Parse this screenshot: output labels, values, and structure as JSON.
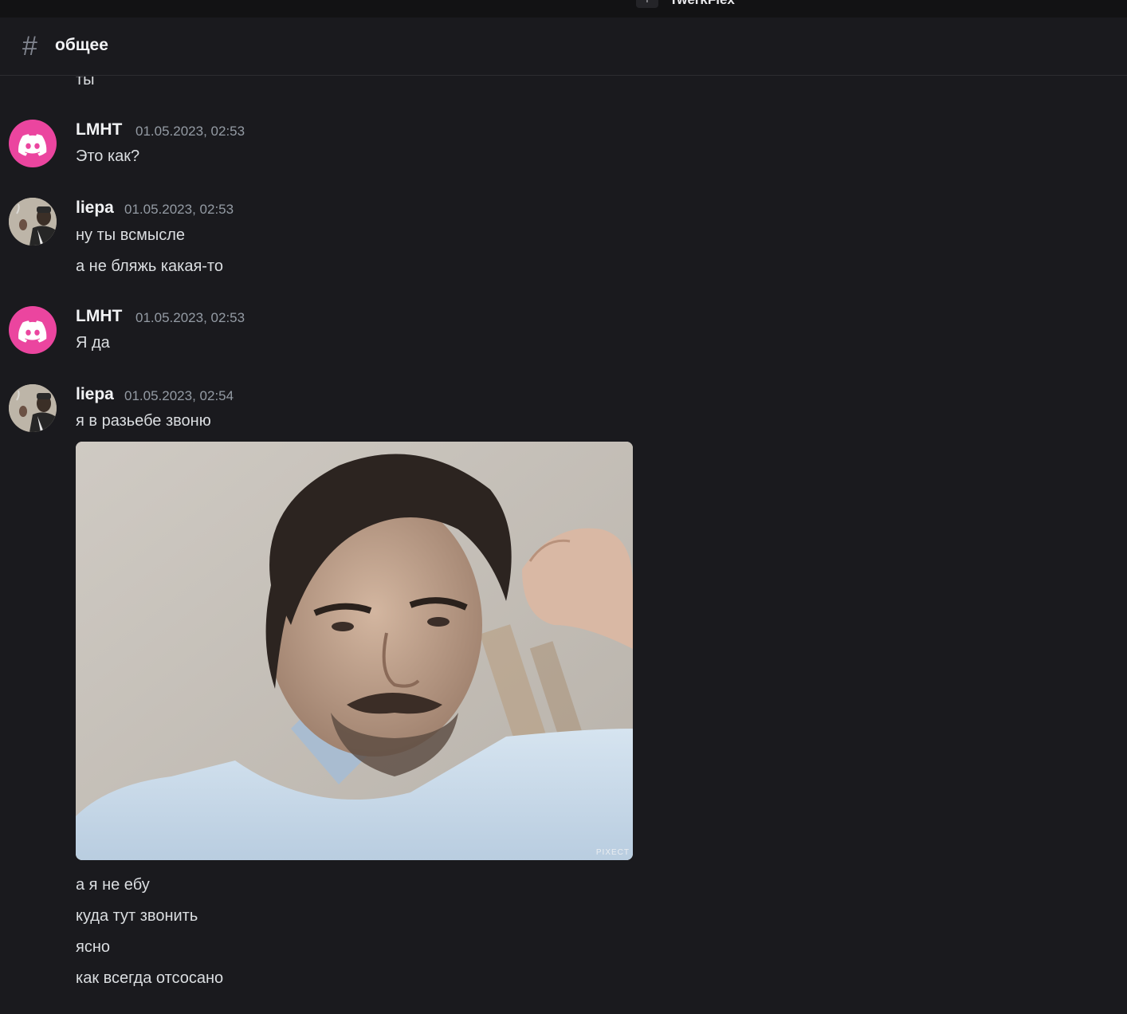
{
  "titlebar": {
    "icon_glyph": "+",
    "text": "TwerkFlex"
  },
  "header": {
    "hash_glyph": "#",
    "channel_name": "общее"
  },
  "messages": {
    "cut_off_text": "ты",
    "groups": [
      {
        "author": "LMHT",
        "timestamp": "01.05.2023, 02:53",
        "avatar": "discord-default-icon",
        "lines": [
          "Это как?"
        ]
      },
      {
        "author": "liepa",
        "timestamp": "01.05.2023, 02:53",
        "avatar": "user-photo-avatar",
        "lines": [
          "ну ты всмысле",
          "а не бляжь какая-то"
        ]
      },
      {
        "author": "LMHT",
        "timestamp": "01.05.2023, 02:53",
        "avatar": "discord-default-icon",
        "lines": [
          "Я да"
        ]
      },
      {
        "author": "liepa",
        "timestamp": "01.05.2023, 02:54",
        "avatar": "user-photo-avatar",
        "lines": [
          "я в разьебе звоню"
        ],
        "attachment": {
          "type": "image",
          "watermark": "PIXECT"
        },
        "lines_after": [
          "а я не ебу",
          "куда тут звонить",
          "ясно",
          "как всегда отсосано"
        ]
      }
    ]
  },
  "colors": {
    "background": "#1a1a1e",
    "discord_avatar": "#eb459f",
    "text": "#dbdee1",
    "timestamp": "#949ba4"
  }
}
